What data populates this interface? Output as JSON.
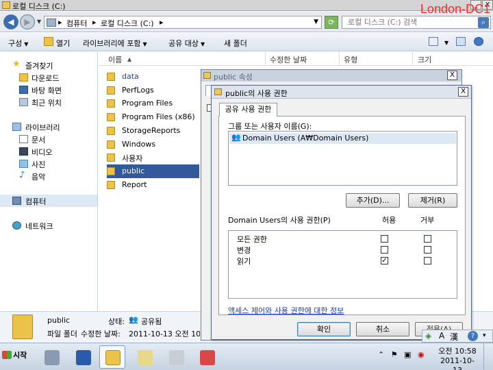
{
  "watermark": "London-DC1",
  "explorer": {
    "title": "로컬 디스크 (C:)",
    "window_buttons": {
      "minimize": "_",
      "close": "X"
    },
    "address": {
      "crumbs": [
        "컴퓨터",
        "로컬 디스크 (C:)"
      ],
      "sep": "▸"
    },
    "search_placeholder": "로컬 디스크 (C:) 검색",
    "toolbar": {
      "organize": "구성",
      "open": "열기",
      "include_library": "라이브러리에 포함",
      "share_with": "공유 대상",
      "new_folder": "새 폴더"
    },
    "nav": {
      "favorites": "즐겨찾기",
      "downloads": "다운로드",
      "desktop": "바탕 화면",
      "recent": "최근 위치",
      "libraries": "라이브러리",
      "documents": "문서",
      "videos": "비디오",
      "pictures": "사진",
      "music": "음악",
      "computer": "컴퓨터",
      "network": "네트워크"
    },
    "columns": {
      "name": "이름",
      "modified": "수정한 날짜",
      "type": "유형",
      "size": "크기"
    },
    "files": [
      "data",
      "PerfLogs",
      "Program Files",
      "Program Files (x86)",
      "StorageReports",
      "Windows",
      "사용자",
      "public",
      "Report"
    ],
    "selected_file": "public",
    "details": {
      "name": "public",
      "type_line": "파일 폴더",
      "state_label": "상태:",
      "state_value": "공유됨",
      "modified_label": "수정한 날짜:",
      "modified_value": "2011-10-13 오전 10:4"
    }
  },
  "back_dialog": {
    "title": "public 속성",
    "close": "X"
  },
  "dialog": {
    "title": "public의 사용 권한",
    "close": "X",
    "tab": "공유 사용 권한",
    "group_label": "그룹 또는 사용자 이름(G):",
    "user": "Domain Users (A₩Domain Users)",
    "add_button": "추가(D)...",
    "remove_button": "제거(R)",
    "perm_label": "Domain Users의 사용 권한(P)",
    "allow": "허용",
    "deny": "거부",
    "permissions": [
      {
        "name": "모든 권한",
        "allow": false,
        "deny": false
      },
      {
        "name": "변경",
        "allow": false,
        "deny": false
      },
      {
        "name": "읽기",
        "allow": true,
        "deny": false
      }
    ],
    "link": "액세스 제어와 사용 권한에 대한 정보",
    "ok": "확인",
    "cancel": "취소",
    "apply": "적용(A)"
  },
  "langbar": {
    "ime": "A",
    "hanja": "漢",
    "help": "?"
  },
  "taskbar": {
    "start": "시작",
    "time": "오전 10:58",
    "date": "2011-10-13"
  }
}
